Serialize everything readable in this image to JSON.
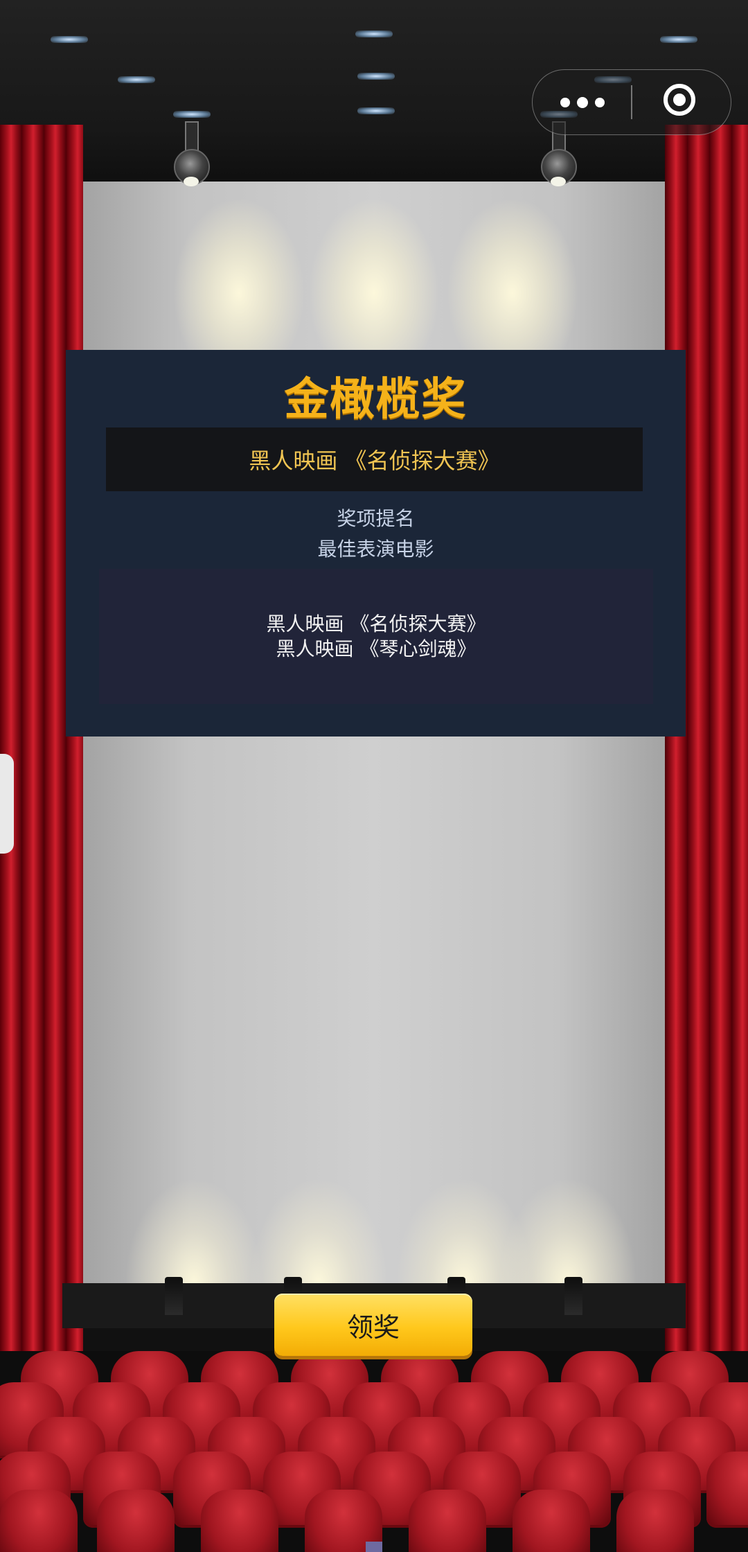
{
  "award": {
    "title": "金橄榄奖",
    "nominated_work": "黑人映画 《名侦探大赛》",
    "section_label": "奖项提名",
    "category": "最佳表演电影",
    "nominees": [
      "黑人映画 《名侦探大赛》",
      "黑人映画 《琴心剑魂》"
    ]
  },
  "actions": {
    "claim_label": "领奖"
  },
  "capsule": {
    "more_icon": "more-dots-icon",
    "close_icon": "target-close-icon"
  },
  "colors": {
    "title_gold": "#f5b21a",
    "panel_bg": "#1b2638",
    "curtain_red": "#c0161f",
    "button_yellow": "#ffc81c"
  }
}
